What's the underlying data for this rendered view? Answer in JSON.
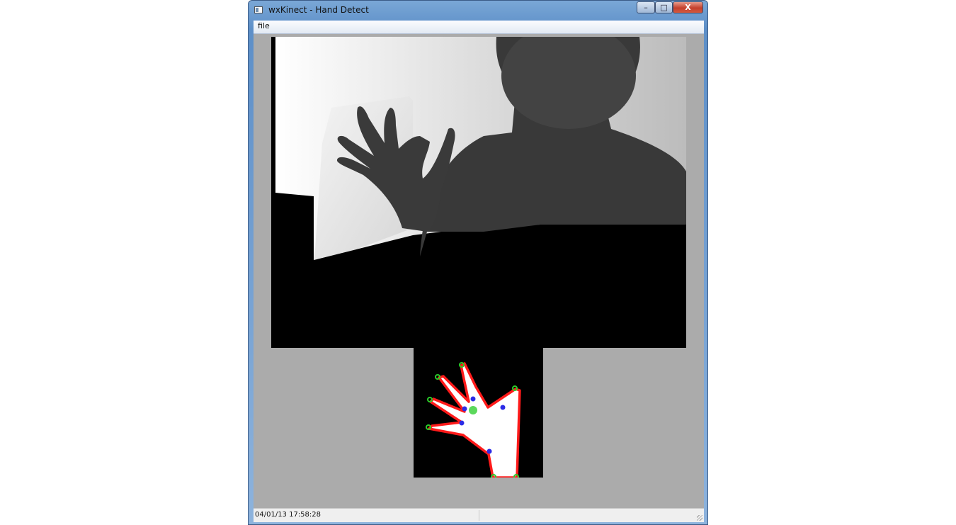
{
  "window": {
    "title": "wxKinect - Hand Detect",
    "controls": {
      "minimize": "–",
      "maximize": "□",
      "close": "X"
    }
  },
  "menu": {
    "items": [
      "file"
    ]
  },
  "status": {
    "datetime": "04/01/13 17:58:28",
    "pane2": ""
  },
  "views": {
    "depth_view": "depth-image",
    "hand_view": "hand-detection"
  },
  "colors": {
    "background": "#ababab",
    "contour": "#ff0000",
    "fingertip": "#22cc22",
    "defect": "#2a2ae0"
  }
}
